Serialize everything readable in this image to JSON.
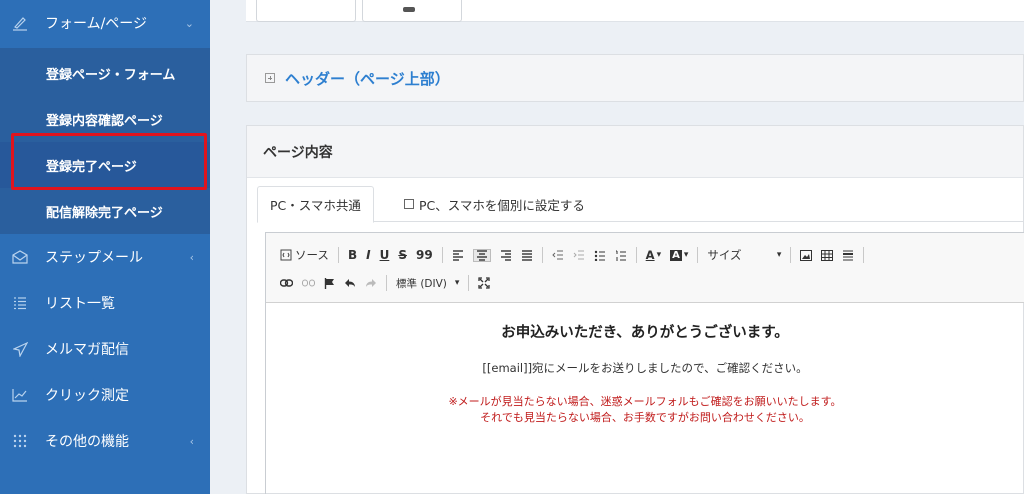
{
  "sidebar": {
    "form_page": {
      "label": "フォーム/ページ",
      "icon": "pencil-icon",
      "arrow": "⌄"
    },
    "submenu": [
      {
        "label": "登録ページ・フォーム"
      },
      {
        "label": "登録内容確認ページ"
      },
      {
        "label": "登録完了ページ"
      },
      {
        "label": "配信解除完了ページ"
      }
    ],
    "items": [
      {
        "label": "ステップメール",
        "icon": "envelope-icon",
        "arrow": "‹"
      },
      {
        "label": "リスト一覧",
        "icon": "list-icon",
        "arrow": ""
      },
      {
        "label": "メルマガ配信",
        "icon": "paper-plane-icon",
        "arrow": ""
      },
      {
        "label": "クリック測定",
        "icon": "chart-line-icon",
        "arrow": ""
      },
      {
        "label": "その他の機能",
        "icon": "grid-icon",
        "arrow": "‹"
      }
    ],
    "highlight_color": "#e0141e"
  },
  "main": {
    "header_box": {
      "title": "ヘッダー（ページ上部）"
    },
    "page_box": {
      "title": "ページ内容",
      "tabs": [
        {
          "label": "PC・スマホ共通"
        },
        {
          "label": "PC、スマホを個別に設定する"
        }
      ]
    },
    "editor": {
      "toolbar": {
        "source": "ソース",
        "bold": "B",
        "italic": "I",
        "underline": "U",
        "strike": "S",
        "quote": "99",
        "size": "サイズ",
        "format": "標準 (DIV)"
      },
      "content": {
        "title": "お申込みいただき、ありがとうございます。",
        "line1": "[[email]]宛にメールをお送りしましたので、ご確認ください。",
        "note1": "※メールが見当たらない場合、迷惑メールフォルもご確認をお願いいたします。",
        "note2": "それでも見当たらない場合、お手数ですがお問い合わせください。"
      }
    }
  }
}
